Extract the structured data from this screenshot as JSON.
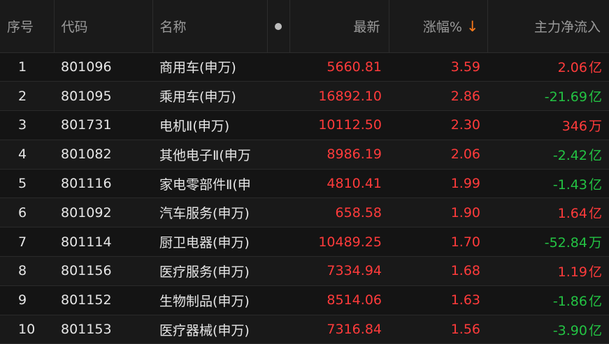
{
  "colors": {
    "up": "#ff3b3b",
    "down": "#23c343",
    "sort_arrow": "#ff7a1a"
  },
  "header": {
    "seq": "序号",
    "code": "代码",
    "name": "名称",
    "dot_icon": "circle-dot-icon",
    "latest": "最新",
    "change": "涨幅%",
    "sort_icon": "arrow-down-icon",
    "sort_arrow": "↓",
    "inflow": "主力净流入"
  },
  "rows": [
    {
      "seq": "1",
      "code": "801096",
      "name": "商用车(申万)",
      "latest": "5660.81",
      "change": "3.59",
      "inflow": "2.06",
      "unit": "亿",
      "dir": "up"
    },
    {
      "seq": "2",
      "code": "801095",
      "name": "乘用车(申万)",
      "latest": "16892.10",
      "change": "2.86",
      "inflow": "-21.69",
      "unit": "亿",
      "dir": "down"
    },
    {
      "seq": "3",
      "code": "801731",
      "name": "电机Ⅱ(申万)",
      "latest": "10112.50",
      "change": "2.30",
      "inflow": "346",
      "unit": "万",
      "dir": "up"
    },
    {
      "seq": "4",
      "code": "801082",
      "name": "其他电子Ⅱ(申万",
      "latest": "8986.19",
      "change": "2.06",
      "inflow": "-2.42",
      "unit": "亿",
      "dir": "down"
    },
    {
      "seq": "5",
      "code": "801116",
      "name": "家电零部件Ⅱ(申",
      "latest": "4810.41",
      "change": "1.99",
      "inflow": "-1.43",
      "unit": "亿",
      "dir": "down"
    },
    {
      "seq": "6",
      "code": "801092",
      "name": "汽车服务(申万)",
      "latest": "658.58",
      "change": "1.90",
      "inflow": "1.64",
      "unit": "亿",
      "dir": "up"
    },
    {
      "seq": "7",
      "code": "801114",
      "name": "厨卫电器(申万)",
      "latest": "10489.25",
      "change": "1.70",
      "inflow": "-52.84",
      "unit": "万",
      "dir": "down"
    },
    {
      "seq": "8",
      "code": "801156",
      "name": "医疗服务(申万)",
      "latest": "7334.94",
      "change": "1.68",
      "inflow": "1.19",
      "unit": "亿",
      "dir": "up"
    },
    {
      "seq": "9",
      "code": "801152",
      "name": "生物制品(申万)",
      "latest": "8514.06",
      "change": "1.63",
      "inflow": "-1.86",
      "unit": "亿",
      "dir": "down"
    },
    {
      "seq": "10",
      "code": "801153",
      "name": "医疗器械(申万)",
      "latest": "7316.84",
      "change": "1.56",
      "inflow": "-3.90",
      "unit": "亿",
      "dir": "down"
    }
  ]
}
